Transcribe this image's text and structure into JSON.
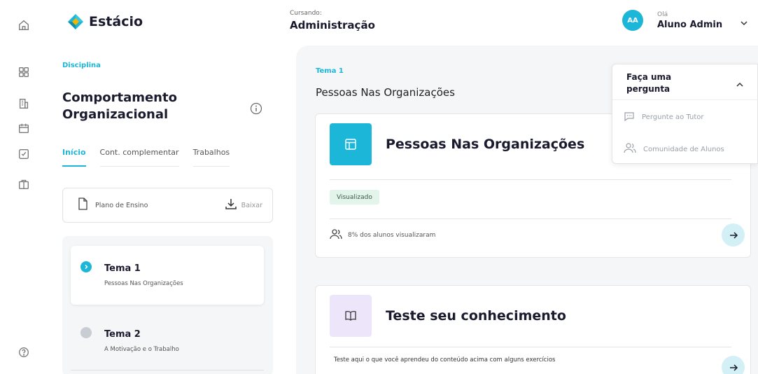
{
  "header": {
    "logo_text": "Estácio",
    "course_label": "Cursando:",
    "course_name": "Administração",
    "user_initials": "AA",
    "user_greeting": "Olá",
    "user_name": "Aluno Admin"
  },
  "sidebar": {
    "icons": [
      "home-icon",
      "grid-icon",
      "building-icon",
      "calendar-icon",
      "checklist-icon",
      "briefcase-icon",
      "help-icon"
    ]
  },
  "discipline": {
    "label": "Disciplina",
    "title": "Comportamento Organizacional",
    "tabs": [
      {
        "label": "Início",
        "active": true
      },
      {
        "label": "Cont. complementar",
        "active": false
      },
      {
        "label": "Trabalhos",
        "active": false
      }
    ],
    "plano_label": "Plano de Ensino",
    "download_label": "Baixar",
    "temas": [
      {
        "title": "Tema 1",
        "subtitle": "Pessoas Nas Organizações",
        "active": true
      },
      {
        "title": "Tema 2",
        "subtitle": "A Motivação e o Trabalho",
        "active": false
      }
    ]
  },
  "main": {
    "tema_label": "Tema 1",
    "tema_title": "Pessoas Nas Organizações",
    "card1": {
      "title": "Pessoas Nas Organizações",
      "badge": "Visualizado",
      "views": "8% dos alunos visualizaram"
    },
    "card2": {
      "title": "Teste seu conhecimento",
      "description": "Teste aqui o que você aprendeu do conteúdo acima com alguns exercícios"
    }
  },
  "question_dropdown": {
    "title": "Faça uma pergunta",
    "items": [
      {
        "label": "Pergunte ao Tutor",
        "icon": "chat-icon"
      },
      {
        "label": "Comunidade de Alunos",
        "icon": "users-icon"
      }
    ]
  },
  "colors": {
    "accent": "#1cb7d8",
    "panel_bg": "#f5f6f8",
    "badge_bg": "#e3f4ea",
    "lilac": "#ede6fb"
  }
}
